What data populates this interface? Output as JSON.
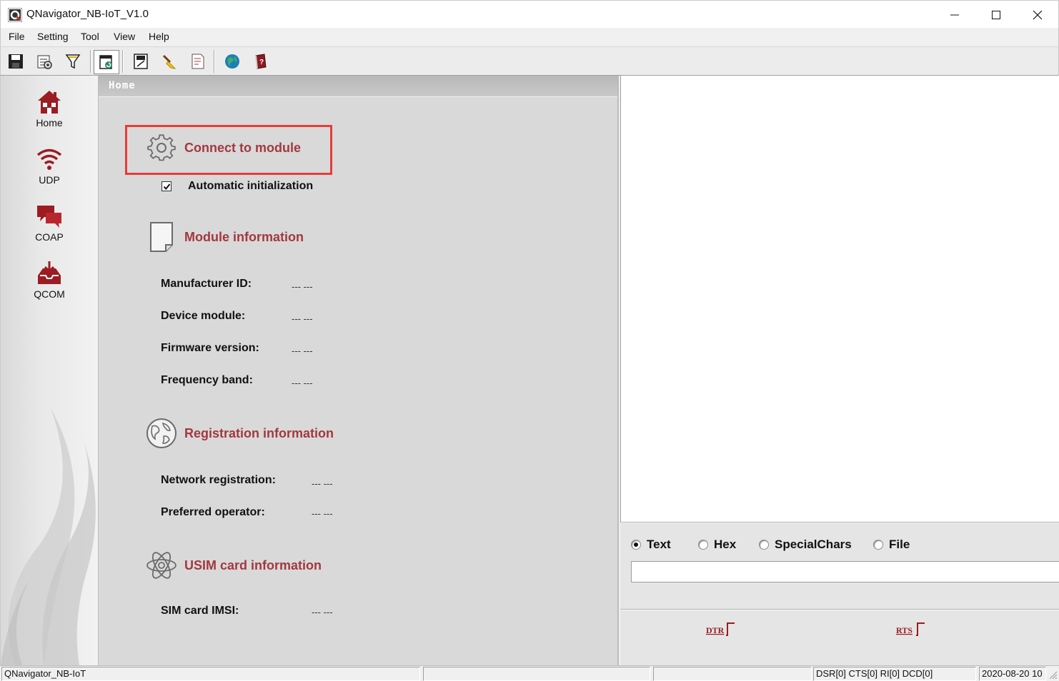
{
  "window": {
    "title": "QNavigator_NB-IoT_V1.0"
  },
  "menu": {
    "items": [
      "File",
      "Setting",
      "Tool",
      "View",
      "Help"
    ]
  },
  "toolbar": {
    "icons": [
      "save-icon",
      "settings-icon",
      "filter-icon",
      "refresh-icon",
      "save-log-icon",
      "clear-icon",
      "document-icon",
      "globe-icon",
      "manual-icon"
    ]
  },
  "nav": {
    "items": [
      {
        "label": "Home",
        "icon": "home-icon"
      },
      {
        "label": "UDP",
        "icon": "wifi-icon"
      },
      {
        "label": "COAP",
        "icon": "chat-icon"
      },
      {
        "label": "QCOM",
        "icon": "inbox-icon"
      }
    ]
  },
  "home": {
    "header": "Home",
    "connect": {
      "label": "Connect to module",
      "icon": "gear-icon"
    },
    "auto_init": {
      "label": "Automatic initialization",
      "checked": true
    },
    "module_info": {
      "title": "Module information",
      "icon": "document-icon",
      "fields": [
        {
          "label": "Manufacturer ID:",
          "value": "--- ---"
        },
        {
          "label": "Device module:",
          "value": "--- ---"
        },
        {
          "label": "Firmware version:",
          "value": "--- ---"
        },
        {
          "label": "Frequency band:",
          "value": "--- ---"
        }
      ]
    },
    "registration": {
      "title": "Registration information",
      "icon": "globe-icon",
      "fields": [
        {
          "label": "Network registration:",
          "value": "--- ---"
        },
        {
          "label": "Preferred operator:",
          "value": "--- ---"
        }
      ]
    },
    "usim": {
      "title": "USIM card information",
      "icon": "atom-icon",
      "fields": [
        {
          "label": "SIM card IMSI:",
          "value": "--- ---"
        }
      ]
    }
  },
  "send": {
    "modes": [
      {
        "label": "Text",
        "selected": true
      },
      {
        "label": "Hex",
        "selected": false
      },
      {
        "label": "SpecialChars",
        "selected": false
      },
      {
        "label": "File",
        "selected": false
      }
    ],
    "input_value": "",
    "dtr_label": "DTR",
    "rts_label": "RTS"
  },
  "status": {
    "app_name": "QNavigator_NB-IoT",
    "cell2": "",
    "cell3": "",
    "signals": "DSR[0] CTS[0] RI[0] DCD[0]",
    "datetime": "2020-08-20 10"
  },
  "colors": {
    "accent": "#a3383f",
    "highlight": "#e83b3b",
    "nav_icon": "#9b1c22"
  }
}
